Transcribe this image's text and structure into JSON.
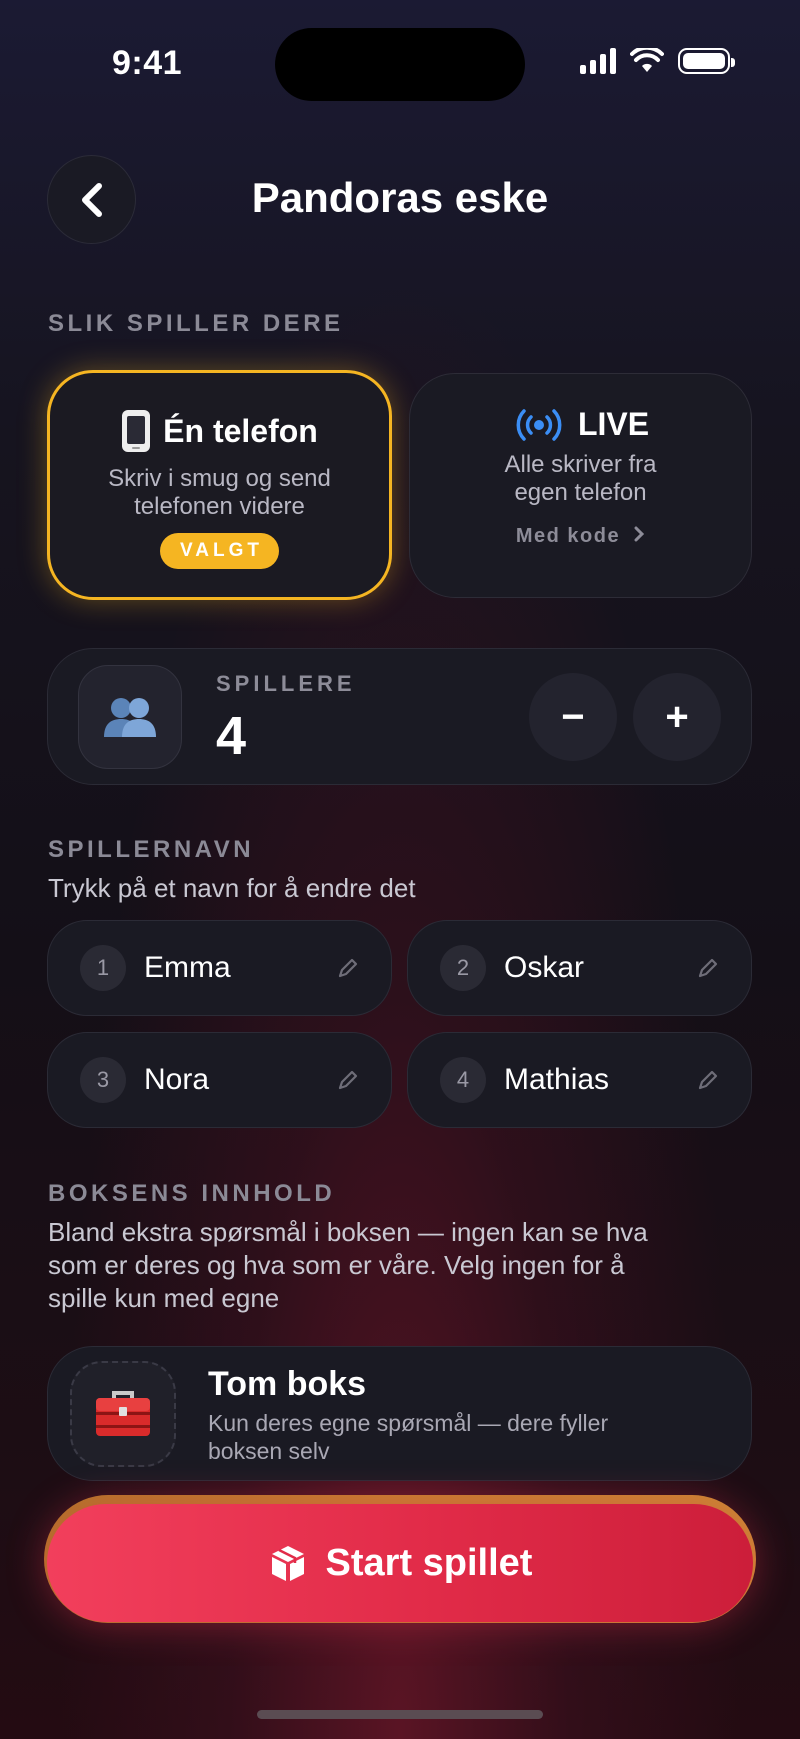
{
  "status_bar": {
    "time": "9:41"
  },
  "header": {
    "title": "Pandoras eske"
  },
  "mode_section": {
    "label": "SLIK SPILLER DERE",
    "one_phone": {
      "title": "Én telefon",
      "description_line1": "Skriv i smug og send",
      "description_line2": "telefonen videre",
      "badge": "VALGT",
      "selected": true
    },
    "live": {
      "title": "LIVE",
      "description_line1": "Alle skriver fra",
      "description_line2": "egen telefon",
      "link": "Med kode"
    }
  },
  "players": {
    "label": "SPILLERE",
    "count": "4",
    "minus_label": "−",
    "plus_label": "+"
  },
  "names_section": {
    "label": "SPILLERNAVN",
    "hint": "Trykk på et navn for å endre det",
    "players": [
      {
        "number": "1",
        "name": "Emma"
      },
      {
        "number": "2",
        "name": "Oskar"
      },
      {
        "number": "3",
        "name": "Nora"
      },
      {
        "number": "4",
        "name": "Mathias"
      }
    ]
  },
  "box_section": {
    "label": "BOKSENS INNHOLD",
    "hint_line1": "Bland ekstra spørsmål i boksen — ingen kan se hva",
    "hint_line2": "som er deres og hva som er våre. Velg ingen for å",
    "hint_line3": "spille kun med egne",
    "option": {
      "title": "Tom boks",
      "description_line1": "Kun deres egne spørsmål — dere fyller",
      "description_line2": "boksen selv"
    }
  },
  "start_button": {
    "label": "Start spillet"
  },
  "colors": {
    "accent": "#f5b522",
    "primary": "#e12b48",
    "live_blue": "#3b8ef5"
  }
}
